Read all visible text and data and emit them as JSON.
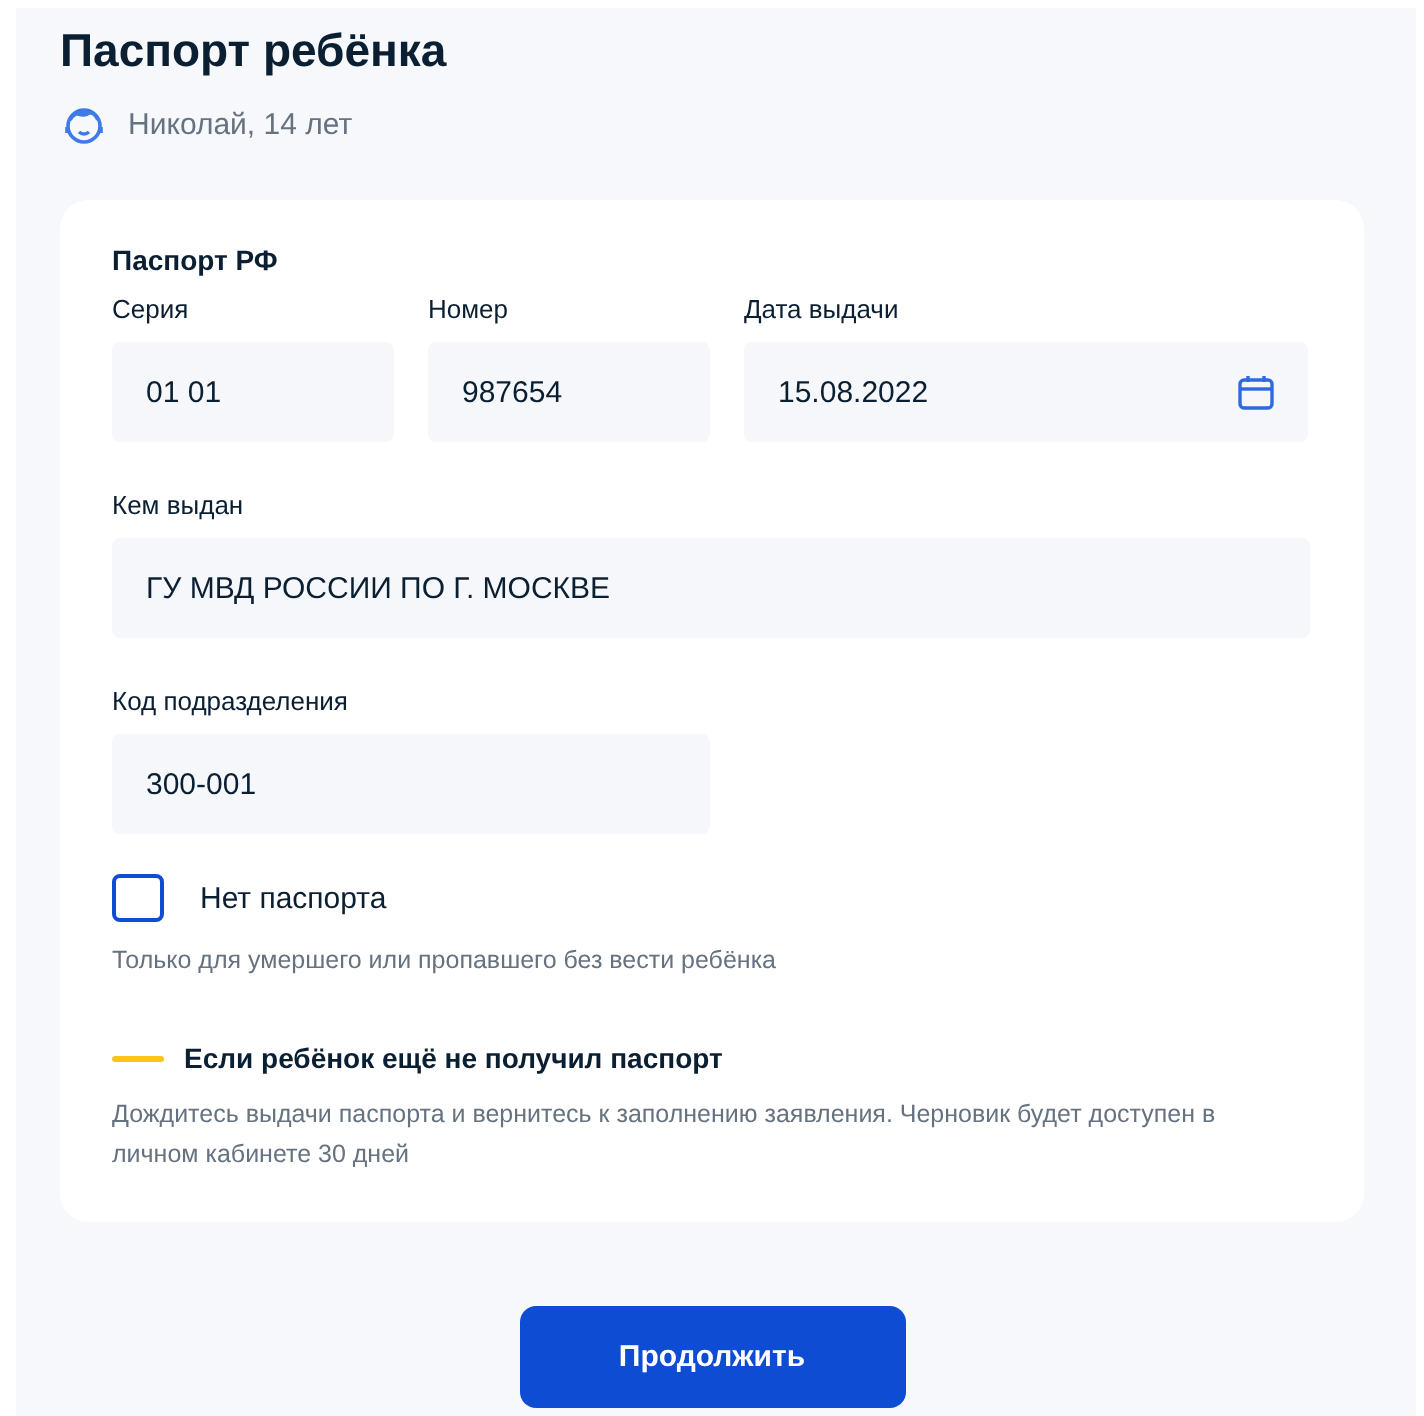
{
  "title": "Паспорт ребёнка",
  "child": "Николай, 14 лет",
  "form": {
    "heading": "Паспорт РФ",
    "rows": [
      [
        {
          "label": "Серия",
          "value": "01 01",
          "kind": "text"
        },
        {
          "label": "Номер",
          "value": "987654",
          "kind": "text"
        },
        {
          "label": "Дата выдачи",
          "value": "15.08.2022",
          "kind": "date"
        }
      ],
      [
        {
          "label": "Кем выдан",
          "value": "ГУ МВД РОССИИ ПО Г. МОСКВЕ",
          "kind": "text"
        }
      ],
      [
        {
          "label": "Код подразделения",
          "value": "300-001",
          "kind": "text"
        }
      ]
    ],
    "checkbox": {
      "label": "Нет паспорта",
      "checked": false,
      "hint": "Только для умершего или пропавшего без вести ребёнка"
    },
    "notice": {
      "title": "Если ребёнок ещё не получил паспорт",
      "text": "Дождитесь выдачи паспорта и вернитесь к заполнению заявления. Черновик будет доступен в личном кабинете 30 дней"
    }
  },
  "button": "Продолжить"
}
